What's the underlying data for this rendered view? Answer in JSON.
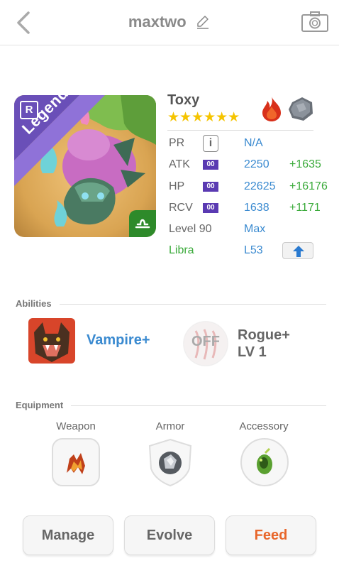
{
  "header": {
    "title": "maxtwo",
    "back_icon": "chevron-left-icon",
    "edit_icon": "pencil-icon",
    "camera_icon": "camera-icon"
  },
  "card": {
    "rarity": "Legendary",
    "rarity_badge": "R",
    "zodiac_icon": "libra-icon"
  },
  "monster": {
    "name": "Toxy",
    "stars": "★★★★★★",
    "star_count": 6,
    "elements": [
      "fire-icon",
      "rock-icon"
    ]
  },
  "stats": {
    "pr": {
      "label": "PR",
      "info": "i",
      "value": "N/A"
    },
    "atk": {
      "label": "ATK",
      "badge": "00",
      "value": "2250",
      "bonus": "+1635"
    },
    "hp": {
      "label": "HP",
      "badge": "00",
      "value": "22625",
      "bonus": "+16176"
    },
    "rcv": {
      "label": "RCV",
      "badge": "00",
      "value": "1638",
      "bonus": "+1171"
    },
    "level": {
      "label": "Level 90",
      "value": "Max"
    },
    "zodiac": {
      "label": "Libra",
      "value": "L53"
    }
  },
  "abilities": {
    "heading": "Abilities",
    "items": [
      {
        "name": "Vampire+"
      },
      {
        "state": "OFF",
        "name_line1": "Rogue+",
        "name_line2": "LV 1"
      }
    ]
  },
  "equipment": {
    "heading": "Equipment",
    "slots": [
      {
        "label": "Weapon"
      },
      {
        "label": "Armor"
      },
      {
        "label": "Accessory"
      }
    ]
  },
  "actions": {
    "manage": "Manage",
    "evolve": "Evolve",
    "feed": "Feed"
  },
  "colors": {
    "accent_blue": "#3a8ad0",
    "bonus_green": "#3aaa3a",
    "star_gold": "#f5c400",
    "legendary_purple": "#6a4fb8",
    "feed_orange": "#e8662a"
  }
}
